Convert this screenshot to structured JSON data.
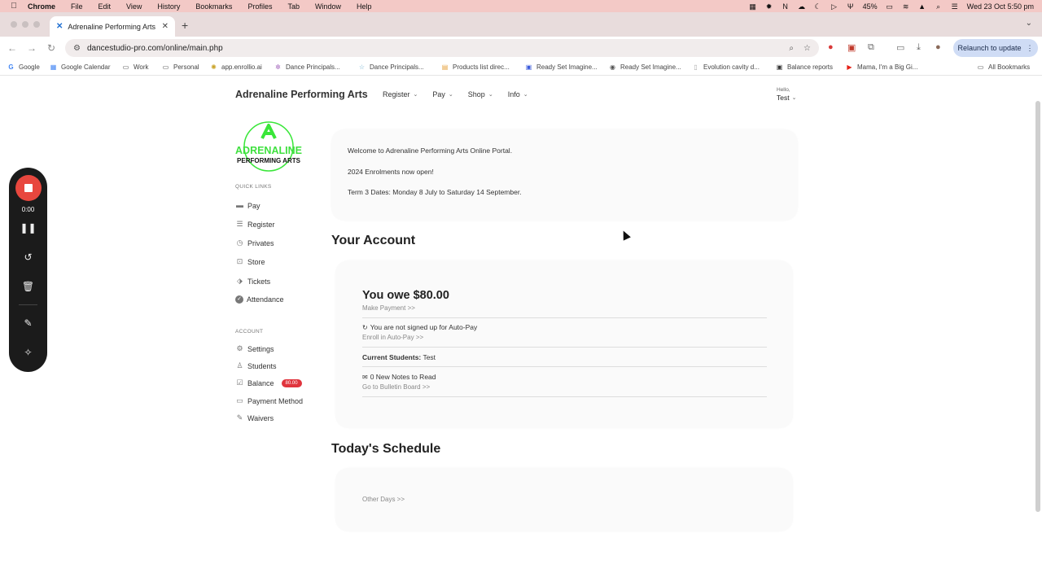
{
  "menubar": {
    "app": "Chrome",
    "items": [
      "File",
      "Edit",
      "View",
      "History",
      "Bookmarks",
      "Profiles",
      "Tab",
      "Window",
      "Help"
    ],
    "battery": "45%",
    "datetime": "Wed 23 Oct  5:50 pm"
  },
  "browser": {
    "tab_title": "Adrenaline Performing Arts",
    "url": "dancestudio-pro.com/online/main.php",
    "relaunch_label": "Relaunch to update",
    "bookmarks": [
      "Google",
      "Google Calendar",
      "Work",
      "Personal",
      "app.enrollio.ai",
      "Dance Principals...",
      "Dance Principals...",
      "Products list direc...",
      "Ready Set Imagine...",
      "Ready Set Imagine...",
      "Evolution cavity d...",
      "Balance reports",
      "Mama, I'm a Big Gi..."
    ],
    "all_bookmarks": "All Bookmarks"
  },
  "site": {
    "brand": "Adrenaline Performing Arts",
    "nav": [
      "Register",
      "Pay",
      "Shop",
      "Info"
    ],
    "hello": "Hello,",
    "user": "Test",
    "logo_line1": "ADRENALINE",
    "logo_line2": "PERFORMING ARTS"
  },
  "sidebar": {
    "quick_links_label": "QUICK LINKS",
    "quick_links": [
      "Pay",
      "Register",
      "Privates",
      "Store",
      "Tickets",
      "Attendance"
    ],
    "account_label": "ACCOUNT",
    "account_links": [
      "Settings",
      "Students",
      "Balance",
      "Payment Method",
      "Waivers"
    ],
    "balance_badge": "80.00"
  },
  "welcome": {
    "line1": "Welcome to Adrenaline Performing Arts Online Portal.",
    "line2": "2024 Enrolments now open!",
    "line3": "Term 3 Dates: Monday 8 July to Saturday 14 September."
  },
  "account": {
    "heading": "Your Account",
    "owe": "You owe $80.00",
    "make_payment": "Make Payment >>",
    "autopay_status": "You are not signed up for Auto-Pay",
    "enroll_autopay": "Enroll in Auto-Pay >>",
    "current_students_label": "Current Students:",
    "current_students_value": " Test",
    "notes": "0 New Notes to Read",
    "bulletin": "Go to Bulletin Board >>"
  },
  "schedule": {
    "heading": "Today's Schedule",
    "other_days": "Other Days >>"
  },
  "recorder": {
    "time": "0:00"
  }
}
